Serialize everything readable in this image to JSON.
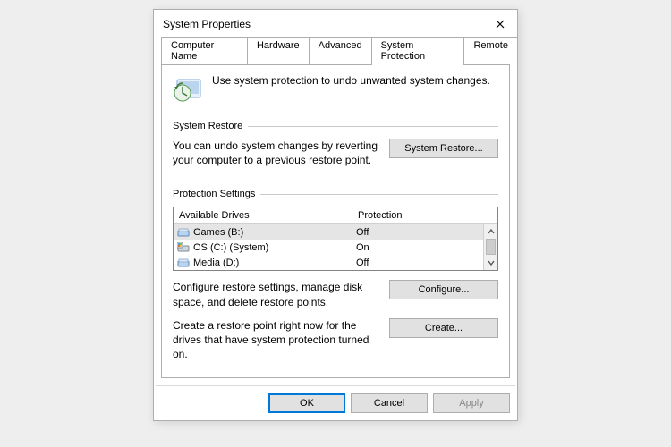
{
  "dialog": {
    "title": "System Properties",
    "tabs": [
      {
        "label": "Computer Name"
      },
      {
        "label": "Hardware"
      },
      {
        "label": "Advanced"
      },
      {
        "label": "System Protection"
      },
      {
        "label": "Remote"
      }
    ],
    "intro": "Use system protection to undo unwanted system changes.",
    "group_restore": {
      "title": "System Restore",
      "desc": "You can undo system changes by reverting your computer to a previous restore point.",
      "button": "System Restore..."
    },
    "group_protection": {
      "title": "Protection Settings",
      "col_drive": "Available Drives",
      "col_prot": "Protection",
      "drives": [
        {
          "name": "Games (B:)",
          "prot": "Off"
        },
        {
          "name": "OS (C:) (System)",
          "prot": "On"
        },
        {
          "name": "Media (D:)",
          "prot": "Off"
        }
      ],
      "configure_desc": "Configure restore settings, manage disk space, and delete restore points.",
      "configure_btn": "Configure...",
      "create_desc": "Create a restore point right now for the drives that have system protection turned on.",
      "create_btn": "Create..."
    },
    "footer": {
      "ok": "OK",
      "cancel": "Cancel",
      "apply": "Apply"
    }
  },
  "colors": {
    "accent": "#0078d7"
  }
}
